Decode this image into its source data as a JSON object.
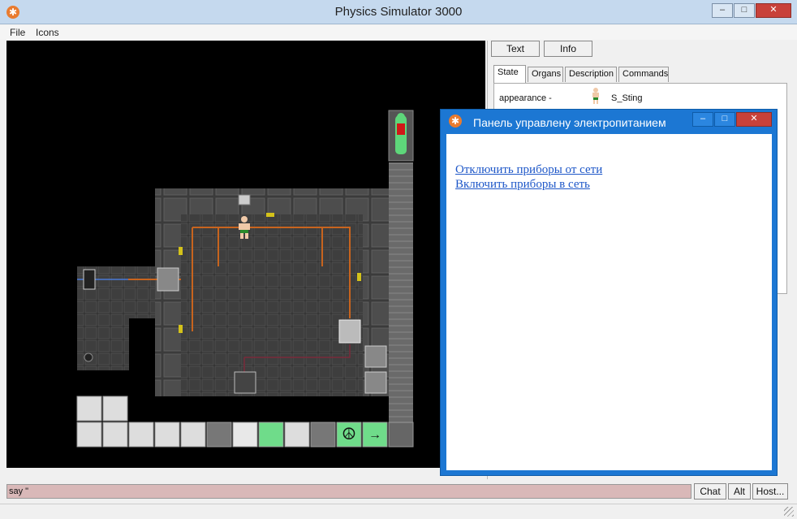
{
  "window": {
    "title": "Physics Simulator 3000"
  },
  "menu": {
    "items": [
      "File",
      "Icons"
    ]
  },
  "right_panel": {
    "top_buttons": [
      "Text",
      "Info"
    ],
    "tabs": [
      "State",
      "Organs",
      "Description",
      "Commands"
    ],
    "state": {
      "label": "appearance -",
      "value": "S_Sting"
    }
  },
  "popup": {
    "title": "Панель управлену электропитанием",
    "links": [
      "Отключить приборы от сети",
      "Включить приборы в сеть"
    ]
  },
  "bottom": {
    "input_value": "say \"",
    "buttons": [
      "Chat",
      "Alt",
      "Host..."
    ]
  },
  "colors": {
    "space": "#000000",
    "floor": "#4a4a4a",
    "wire": "#c8641e",
    "popup_accent": "#1c77d3",
    "input_bg": "#d9b8b8"
  }
}
